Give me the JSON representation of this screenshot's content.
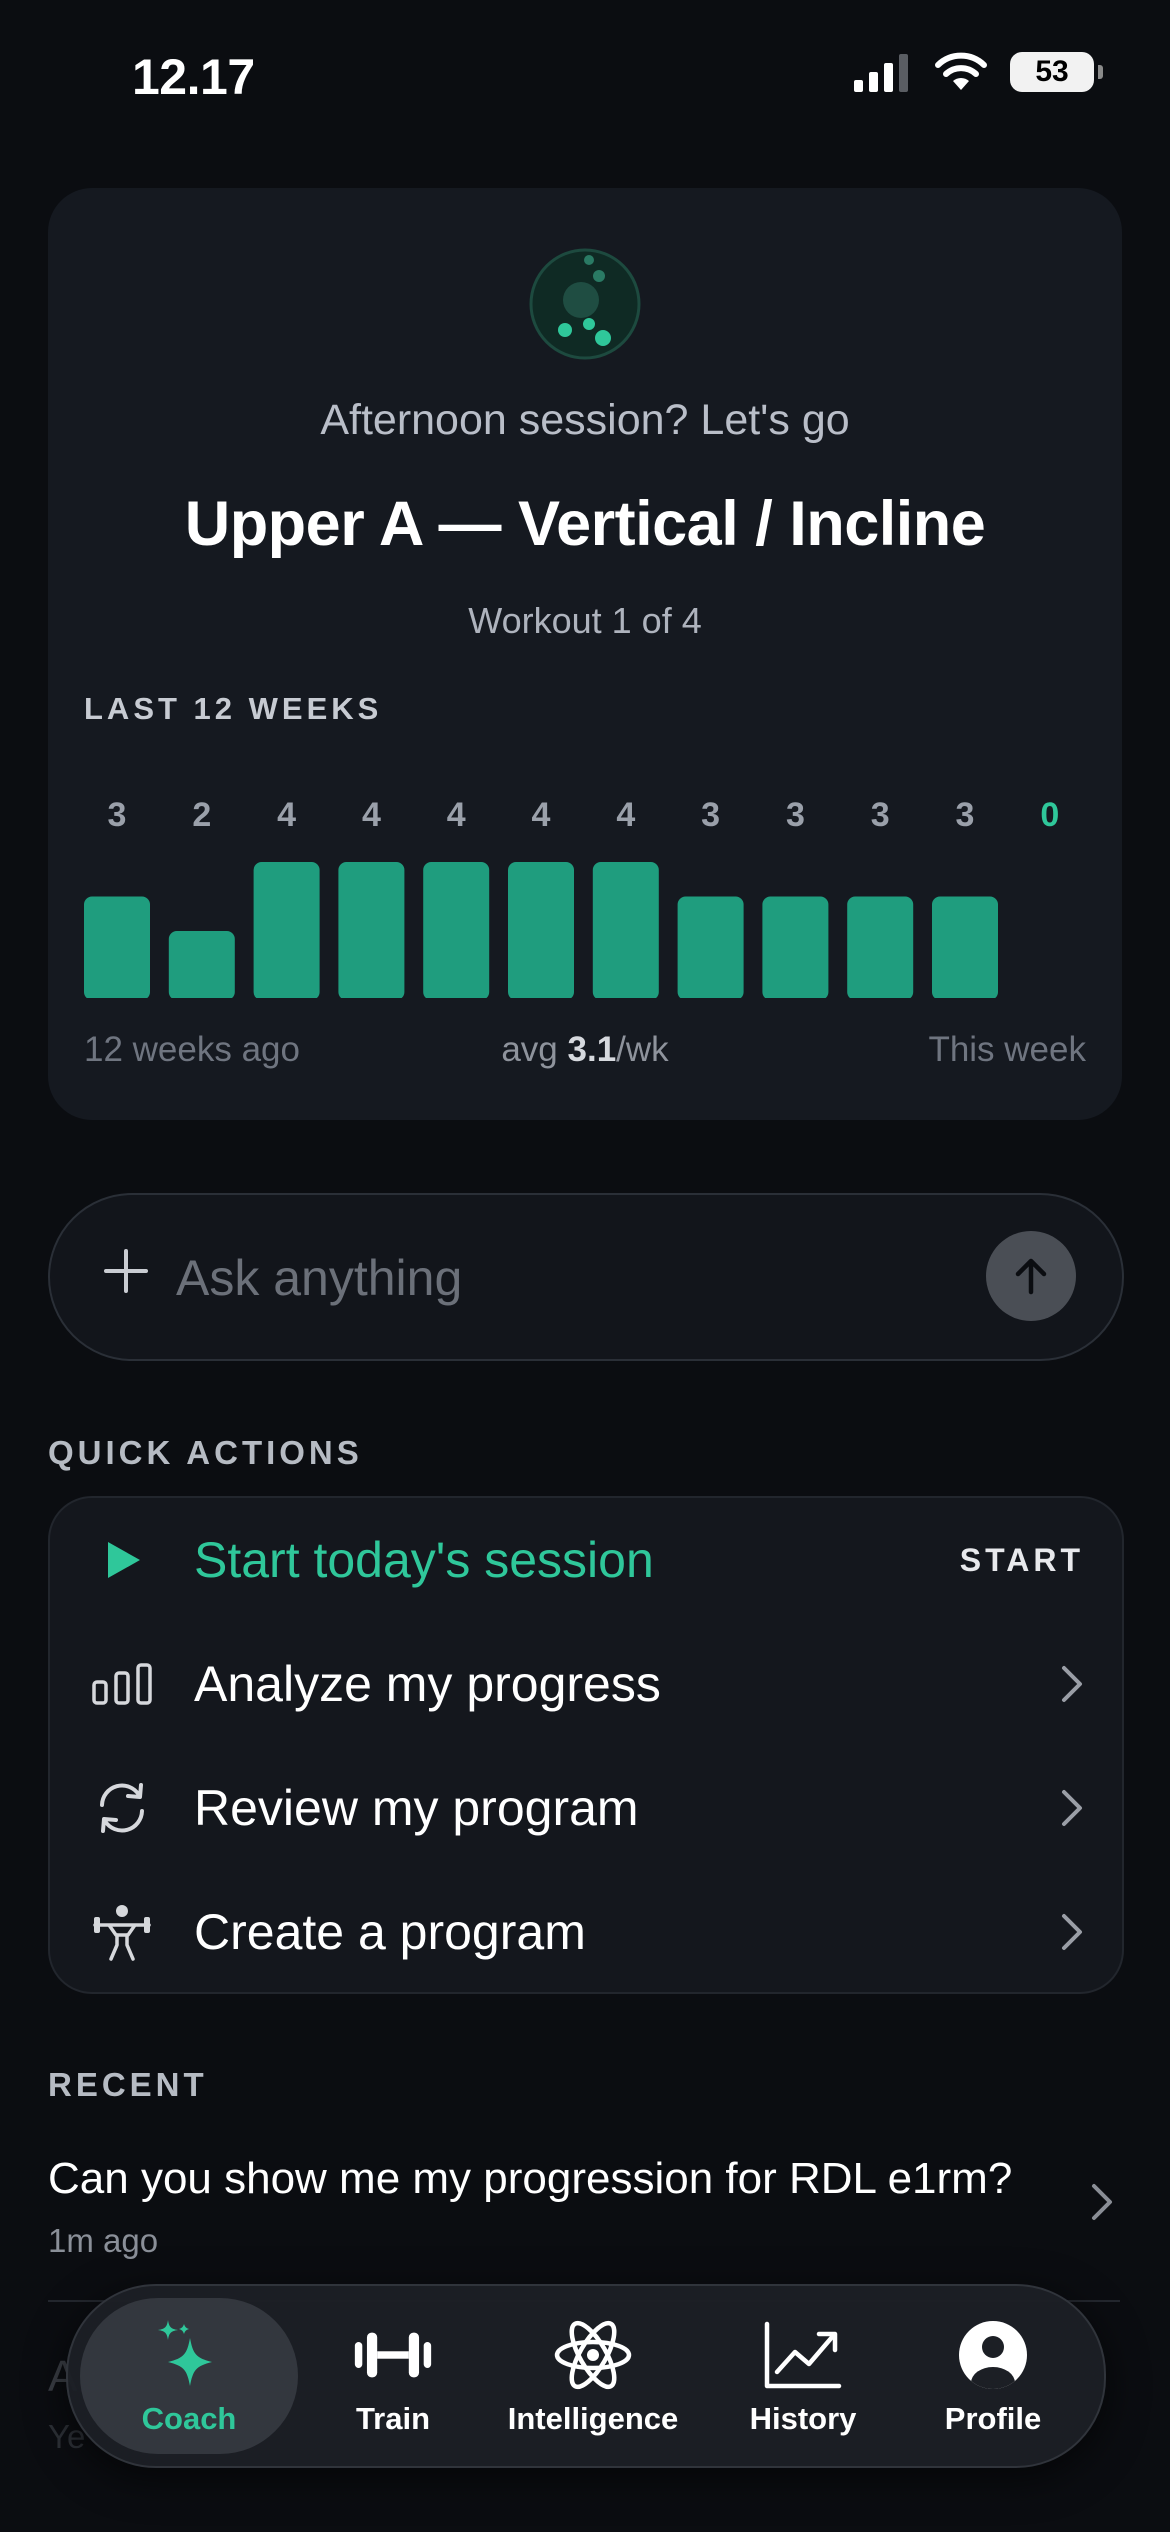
{
  "status_bar": {
    "time": "12.17",
    "battery": "53"
  },
  "hero": {
    "greeting": "Afternoon session? Let's go",
    "workout_title": "Upper A — Vertical / Incline",
    "workout_sub": "Workout 1 of 4",
    "weeks_label": "LAST 12 WEEKS",
    "axis_left": "12 weeks ago",
    "avg_prefix": "avg",
    "avg_value": "3.1",
    "avg_suffix": "/wk",
    "axis_right": "This week"
  },
  "chart_data": {
    "type": "bar",
    "categories": [
      "1",
      "2",
      "3",
      "4",
      "5",
      "6",
      "7",
      "8",
      "9",
      "10",
      "11",
      "12"
    ],
    "values": [
      3,
      2,
      4,
      4,
      4,
      4,
      4,
      3,
      3,
      3,
      3,
      0
    ],
    "title": "LAST 12 WEEKS",
    "xlabel": "",
    "ylabel": "",
    "ylim": [
      0,
      4
    ],
    "bar_color": "#1f9d7e",
    "current_label_color": "#2fc79a",
    "label_color": "#9aa0aa"
  },
  "ask": {
    "placeholder": "Ask anything",
    "value": ""
  },
  "quick_actions": {
    "label": "QUICK ACTIONS",
    "items": [
      {
        "label": "Start today's session",
        "right": "START",
        "icon": "play-icon"
      },
      {
        "label": "Analyze my progress",
        "icon": "bar-chart-icon"
      },
      {
        "label": "Review my program",
        "icon": "refresh-icon"
      },
      {
        "label": "Create a program",
        "icon": "weightlifter-icon"
      }
    ]
  },
  "recent": {
    "label": "RECENT",
    "items": [
      {
        "title": "Can you show me my progression for RDL e1rm?",
        "time": "1m ago"
      }
    ],
    "partial_title": "A",
    "partial_time": "Ye"
  },
  "tabbar": {
    "tabs": [
      {
        "label": "Coach",
        "icon": "sparkle-icon"
      },
      {
        "label": "Train",
        "icon": "dumbbell-icon"
      },
      {
        "label": "Intelligence",
        "icon": "atom-icon"
      },
      {
        "label": "History",
        "icon": "trend-icon"
      },
      {
        "label": "Profile",
        "icon": "person-icon"
      }
    ]
  },
  "colors": {
    "accent": "#2fc79a",
    "background": "#0b0d11",
    "card": "#151920"
  }
}
